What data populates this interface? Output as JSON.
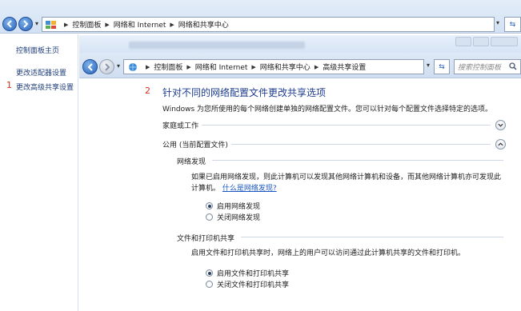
{
  "outer_window": {
    "breadcrumbs": [
      "控制面板",
      "网络和 Internet",
      "网络和共享中心"
    ]
  },
  "left_pane": {
    "links": [
      "控制面板主页",
      "更改适配器设置",
      "更改高级共享设置"
    ],
    "marker": "1"
  },
  "inner_window": {
    "breadcrumbs": [
      "控制面板",
      "网络和 Internet",
      "网络和共享中心",
      "高级共享设置"
    ],
    "search_placeholder": "搜索控制面板"
  },
  "content": {
    "marker": "2",
    "heading": "针对不同的网络配置文件更改共享选项",
    "description": "Windows 为您所使用的每个网络创建单独的网络配置文件。您可以针对每个配置文件选择特定的选项。",
    "profiles": [
      {
        "label": "家庭或工作",
        "expanded": false
      },
      {
        "label": "公用 (当前配置文件)",
        "expanded": true
      }
    ],
    "network_discovery": {
      "title": "网络发现",
      "text_line1": "如果已启用网络发现，则此计算机可以发现其他网络计算机和设备，而其他网络计算机亦可发现此",
      "text_line2": "计算机。",
      "link": "什么是网络发现?",
      "options": [
        {
          "label": "启用网络发现",
          "checked": true
        },
        {
          "label": "关闭网络发现",
          "checked": false
        }
      ]
    },
    "file_printer_sharing": {
      "title": "文件和打印机共享",
      "text": "启用文件和打印机共享时，网络上的用户可以访问通过此计算机共享的文件和打印机。",
      "options": [
        {
          "label": "启用文件和打印机共享",
          "checked": true
        },
        {
          "label": "关闭文件和打印机共享",
          "checked": false
        }
      ]
    }
  }
}
